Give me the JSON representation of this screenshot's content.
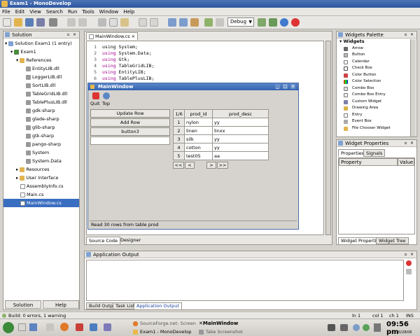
{
  "window": {
    "title": "Exam1 - MonoDevelop"
  },
  "menu": [
    "File",
    "Edit",
    "View",
    "Search",
    "Run",
    "Tools",
    "Window",
    "Help"
  ],
  "toolbar": {
    "config": "Debug"
  },
  "solution": {
    "header": "Solution",
    "root": "Solution Exam1 (1 entry)",
    "project": "Exam1",
    "references_label": "References",
    "references": [
      "EntityLIB.dll",
      "LoggerLIB.dll",
      "SortLIB.dll",
      "TableGridLIB.dll",
      "TablePlusLIB.dll",
      "gdk-sharp",
      "glade-sharp",
      "glib-sharp",
      "gtk-sharp",
      "pango-sharp",
      "System",
      "System.Data"
    ],
    "resources": "Resources",
    "user_interface": "User Interface",
    "files": [
      "AssemblyInfo.cs",
      "Main.cs",
      "MainWindow.cs"
    ],
    "tab_solution": "Solution",
    "tab_help": "Help"
  },
  "editor": {
    "tab": "MainWindow.cs",
    "lines": [
      {
        "n": "1",
        "kw": "",
        "text": "using System;"
      },
      {
        "n": "2",
        "kw": "using",
        "text": " System.Data;"
      },
      {
        "n": "3",
        "kw": "using",
        "text": " Gtk;"
      },
      {
        "n": "4",
        "kw": "using",
        "text": " TableGridLIB;"
      },
      {
        "n": "5",
        "kw": "using",
        "text": " EntityLIB;"
      },
      {
        "n": "6",
        "kw": "using",
        "text": " TablePlusLIB;"
      }
    ],
    "tab_source": "Source Code",
    "tab_designer": "Designer"
  },
  "designer": {
    "title": "MainWindow",
    "quit": "Quit",
    "top": "Top",
    "buttons": [
      "Update Row",
      "Add Row",
      "button3"
    ],
    "page": "1/6",
    "col1": "prod_id",
    "col2": "prod_desc",
    "rows": [
      {
        "n": "1",
        "id": "nylon",
        "desc": "yy"
      },
      {
        "n": "2",
        "id": "linen",
        "desc": "linxx"
      },
      {
        "n": "3",
        "id": "silk",
        "desc": "yy"
      },
      {
        "n": "4",
        "id": "cotton",
        "desc": "yy"
      },
      {
        "n": "5",
        "id": "test05",
        "desc": "aa"
      }
    ],
    "nav": [
      "<<",
      "<",
      ">",
      ">>"
    ],
    "status": "Read 30 rows from table prod"
  },
  "palette": {
    "header": "Widgets Palette",
    "group": "Widgets",
    "items": [
      "Arrow",
      "Button",
      "Calendar",
      "Check Box",
      "Color Button",
      "Color Selection",
      "Combo Box",
      "Combo Box Entry",
      "Custom Widget",
      "Drawing Area",
      "Entry",
      "Event Box",
      "File Chooser Widget"
    ]
  },
  "properties": {
    "header": "Widget Properties",
    "tab_props": "Properties",
    "tab_signals": "Signals",
    "col_prop": "Property",
    "col_value": "Value",
    "bottom_tab1": "Widget Properties",
    "bottom_tab2": "Widget Tree"
  },
  "output": {
    "header": "Application Output",
    "tabs": [
      "Build Output",
      "Task List",
      "Application Output"
    ]
  },
  "status": {
    "build": "Build: 0 errors, 1 warning",
    "ln": "ln 1",
    "col": "col 1",
    "ch": "ch 1",
    "ins": "INS"
  },
  "taskbar": {
    "task1": "SourceForge.net: Screen",
    "task2": "MainWindow",
    "task3": "Exam1 - MonoDevelop",
    "task4": "Take Screenshot",
    "time": "09:56 pm",
    "date": "10/28/06"
  }
}
